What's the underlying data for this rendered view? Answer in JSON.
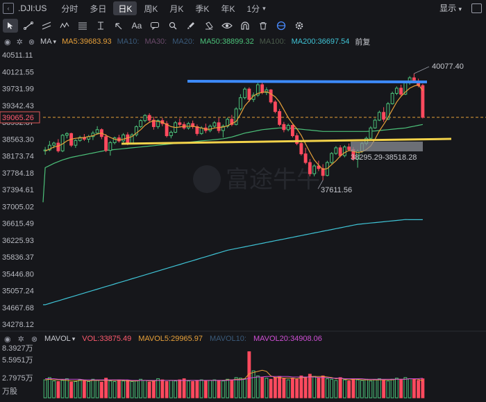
{
  "header": {
    "symbol": ".DJI:US",
    "tabs": [
      "分时",
      "多日",
      "日K",
      "周K",
      "月K",
      "季K",
      "年K",
      "1分"
    ],
    "active_tab": "日K",
    "display_label": "显示"
  },
  "toolbar": {
    "text_tool": "Aa",
    "icons": [
      "cursor-icon",
      "trendline-icon",
      "channel-icon",
      "wave-icon",
      "fib-icon",
      "ruler-icon",
      "arrow-icon",
      "text-icon",
      "comment-icon",
      "zoom-icon",
      "brush-icon",
      "eraser-icon",
      "eye-icon",
      "magnet-icon",
      "trash-icon",
      "sync-icon",
      "settings-icon"
    ]
  },
  "ma_legend": {
    "label": "MA",
    "items": [
      {
        "text": "MA5:39683.93",
        "color": "#e8a13a"
      },
      {
        "text": "MA10:",
        "color": "#3a5a7a"
      },
      {
        "text": "MA30:",
        "color": "#6a4a6a"
      },
      {
        "text": "MA20:",
        "color": "#3a5a7a"
      },
      {
        "text": "MA50:38899.32",
        "color": "#4cc27a"
      },
      {
        "text": "MA100:",
        "color": "#4a5a4a"
      },
      {
        "text": "MA200:36697.54",
        "color": "#3fc4d6"
      },
      {
        "text": "前复",
        "color": "#c7c9cf"
      }
    ]
  },
  "vol_legend": {
    "label": "MAVOL",
    "items": [
      {
        "text": "VOL:33875.49",
        "color": "#ff5a6e"
      },
      {
        "text": "MAVOL5:29965.97",
        "color": "#e8a13a"
      },
      {
        "text": "MAVOL10:",
        "color": "#3a5a7a"
      },
      {
        "text": "MAVOL20:34908.06",
        "color": "#d04fd6"
      }
    ]
  },
  "watermark": "富途牛牛",
  "chart_data": {
    "type": "candlestick",
    "y_ticks": [
      "40511.11",
      "40121.55",
      "39731.99",
      "39342.43",
      "38952.87",
      "38563.30",
      "38173.74",
      "37784.18",
      "37394.61",
      "37005.02",
      "36615.49",
      "36225.93",
      "35836.37",
      "35446.80",
      "35057.24",
      "34667.68",
      "34278.12"
    ],
    "ylim": [
      34278.12,
      40511.11
    ],
    "current_price": "39065.26",
    "annotations": {
      "high_label": "40077.40",
      "low_label": "37611.56",
      "range_label": "38295.29-38518.28"
    },
    "candles": [
      [
        38290,
        38380,
        38200,
        38310
      ],
      [
        38310,
        38520,
        38280,
        38420
      ],
      [
        38420,
        38500,
        38350,
        38470
      ],
      [
        38470,
        38560,
        38250,
        38290
      ],
      [
        38290,
        38680,
        38260,
        38650
      ],
      [
        38650,
        38720,
        38580,
        38690
      ],
      [
        38690,
        38710,
        38380,
        38420
      ],
      [
        38420,
        38560,
        38360,
        38530
      ],
      [
        38530,
        38640,
        38500,
        38600
      ],
      [
        38600,
        38680,
        38520,
        38560
      ],
      [
        38560,
        38660,
        38480,
        38620
      ],
      [
        38620,
        38750,
        38540,
        38700
      ],
      [
        38700,
        38860,
        38670,
        38780
      ],
      [
        38780,
        38810,
        38560,
        38620
      ],
      [
        38620,
        38680,
        38260,
        38300
      ],
      [
        38300,
        38520,
        38180,
        38480
      ],
      [
        38480,
        38620,
        38440,
        38590
      ],
      [
        38590,
        38660,
        38480,
        38520
      ],
      [
        38520,
        38700,
        38480,
        38660
      ],
      [
        38660,
        38720,
        38420,
        38460
      ],
      [
        38460,
        38700,
        38440,
        38660
      ],
      [
        38660,
        38880,
        38620,
        38850
      ],
      [
        38850,
        39020,
        38820,
        38990
      ],
      [
        38990,
        39140,
        38950,
        39110
      ],
      [
        39110,
        39160,
        38960,
        39000
      ],
      [
        39000,
        39080,
        38780,
        38850
      ],
      [
        38850,
        39020,
        38800,
        38990
      ],
      [
        38990,
        39050,
        38860,
        38920
      ],
      [
        38920,
        38980,
        38600,
        38640
      ],
      [
        38640,
        38760,
        38580,
        38720
      ],
      [
        38720,
        38980,
        38700,
        38940
      ],
      [
        38940,
        39040,
        38850,
        38900
      ],
      [
        38900,
        38960,
        38780,
        38820
      ],
      [
        38820,
        38960,
        38780,
        38920
      ],
      [
        38920,
        38990,
        38800,
        38850
      ],
      [
        38850,
        38900,
        38640,
        38690
      ],
      [
        38690,
        38860,
        38660,
        38820
      ],
      [
        38820,
        38920,
        38700,
        38760
      ],
      [
        38760,
        38900,
        38720,
        38860
      ],
      [
        38860,
        38980,
        38820,
        38940
      ],
      [
        38940,
        39050,
        38700,
        38760
      ],
      [
        38760,
        38900,
        38600,
        38860
      ],
      [
        38860,
        39060,
        38820,
        39020
      ],
      [
        39020,
        39120,
        38860,
        38900
      ],
      [
        38900,
        39300,
        38880,
        39260
      ],
      [
        39260,
        39600,
        39220,
        39520
      ],
      [
        39520,
        39760,
        39480,
        39720
      ],
      [
        39720,
        39760,
        39420,
        39480
      ],
      [
        39480,
        39640,
        39420,
        39580
      ],
      [
        39580,
        39860,
        39540,
        39820
      ],
      [
        39820,
        39880,
        39600,
        39640
      ],
      [
        39640,
        39760,
        39580,
        39700
      ],
      [
        39700,
        39720,
        39380,
        39420
      ],
      [
        39420,
        39460,
        39160,
        39200
      ],
      [
        39200,
        39260,
        38860,
        38900
      ],
      [
        38900,
        38960,
        38720,
        38780
      ],
      [
        38780,
        38920,
        38740,
        38880
      ],
      [
        38880,
        38900,
        38600,
        38640
      ],
      [
        38640,
        38700,
        38420,
        38460
      ],
      [
        38460,
        38520,
        38180,
        38220
      ],
      [
        38220,
        38360,
        37980,
        38020
      ],
      [
        38020,
        38100,
        37700,
        37760
      ],
      [
        37760,
        37980,
        37700,
        37940
      ],
      [
        37940,
        38060,
        37820,
        37880
      ],
      [
        37880,
        37980,
        37611.56,
        37720
      ],
      [
        37720,
        38060,
        37700,
        38020
      ],
      [
        38020,
        38260,
        37990,
        38230
      ],
      [
        38230,
        38400,
        38200,
        38360
      ],
      [
        38360,
        38420,
        38140,
        38180
      ],
      [
        38180,
        38420,
        38140,
        38380
      ],
      [
        38380,
        38460,
        38280,
        38320
      ],
      [
        38320,
        38380,
        38060,
        38100
      ],
      [
        38100,
        38320,
        37900,
        38280
      ],
      [
        38280,
        38500,
        38240,
        38460
      ],
      [
        38460,
        38620,
        38420,
        38580
      ],
      [
        38580,
        38860,
        38560,
        38820
      ],
      [
        38820,
        39040,
        38800,
        39000
      ],
      [
        39000,
        39220,
        38980,
        39180
      ],
      [
        39180,
        39300,
        38960,
        39020
      ],
      [
        39020,
        39420,
        39000,
        39380
      ],
      [
        39380,
        39660,
        39360,
        39620
      ],
      [
        39620,
        39780,
        39580,
        39740
      ],
      [
        39740,
        39820,
        39560,
        39600
      ],
      [
        39600,
        39900,
        39580,
        39860
      ],
      [
        39860,
        40020,
        39820,
        39980
      ],
      [
        39980,
        40077.4,
        39860,
        39900
      ],
      [
        39900,
        39960,
        39760,
        39800
      ],
      [
        39800,
        39840,
        39040,
        39065.26
      ]
    ],
    "ma5": [
      38290,
      38330,
      38380,
      38400,
      38450,
      38520,
      38560,
      38580,
      38590,
      38600,
      38620,
      38640,
      38680,
      38700,
      38650,
      38600,
      38560,
      38540,
      38560,
      38590,
      38620,
      38700,
      38780,
      38880,
      38950,
      38990,
      38970,
      38950,
      38900,
      38850,
      38830,
      38840,
      38860,
      38860,
      38860,
      38840,
      38820,
      38790,
      38790,
      38820,
      38830,
      38840,
      38870,
      38920,
      38970,
      39140,
      39330,
      39450,
      39560,
      39620,
      39640,
      39660,
      39610,
      39540,
      39420,
      39240,
      39060,
      38920,
      38800,
      38650,
      38450,
      38260,
      38080,
      37960,
      37860,
      37880,
      37970,
      38060,
      38170,
      38250,
      38300,
      38280,
      38250,
      38270,
      38320,
      38400,
      38560,
      38750,
      38900,
      39060,
      39240,
      39420,
      39550,
      39650,
      39740,
      39790,
      39820,
      39683.93
    ],
    "ma50": [
      37900,
      37950,
      38000,
      38040,
      38080,
      38110,
      38140,
      38160,
      38180,
      38200,
      38220,
      38240,
      38260,
      38280,
      38300,
      38310,
      38320,
      38330,
      38340,
      38350,
      38360,
      38370,
      38380,
      38390,
      38400,
      38410,
      38420,
      38430,
      38440,
      38450,
      38460,
      38470,
      38480,
      38490,
      38500,
      38510,
      38520,
      38530,
      38540,
      38550,
      38560,
      38570,
      38590,
      38610,
      38640,
      38670,
      38700,
      38720,
      38740,
      38760,
      38780,
      38790,
      38800,
      38810,
      38820,
      38820,
      38820,
      38810,
      38800,
      38790,
      38780,
      38770,
      38760,
      38750,
      38740,
      38740,
      38740,
      38740,
      38740,
      38740,
      38740,
      38740,
      38740,
      38740,
      38740,
      38745,
      38750,
      38760,
      38770,
      38780,
      38790,
      38800,
      38810,
      38820,
      38840,
      38860,
      38880,
      38899.32
    ],
    "ma200": [
      34730,
      34760,
      34790,
      34820,
      34850,
      34880,
      34910,
      34940,
      34970,
      35000,
      35030,
      35060,
      35090,
      35120,
      35150,
      35180,
      35210,
      35240,
      35270,
      35300,
      35330,
      35360,
      35390,
      35420,
      35450,
      35480,
      35510,
      35540,
      35570,
      35600,
      35630,
      35660,
      35690,
      35720,
      35750,
      35780,
      35810,
      35840,
      35870,
      35900,
      35930,
      35960,
      35990,
      36010,
      36030,
      36050,
      36070,
      36090,
      36110,
      36130,
      36150,
      36170,
      36190,
      36210,
      36230,
      36250,
      36270,
      36290,
      36310,
      36330,
      36350,
      36370,
      36390,
      36410,
      36430,
      36450,
      36470,
      36490,
      36510,
      36530,
      36550,
      36570,
      36590,
      36600,
      36610,
      36620,
      36630,
      36640,
      36650,
      36660,
      36670,
      36680,
      36690,
      36700,
      36697.54,
      36697.54,
      36697.54,
      36697.54
    ],
    "volume": {
      "y_ticks": [
        "8.3927万",
        "5.5951万",
        "2.7975万",
        "万股"
      ],
      "ylim": [
        0,
        8.3927
      ],
      "values": [
        3.2,
        3.6,
        3.0,
        2.9,
        3.1,
        3.4,
        2.8,
        2.9,
        3.2,
        3.0,
        2.9,
        3.3,
        3.1,
        2.8,
        3.5,
        3.0,
        2.9,
        3.2,
        3.0,
        3.1,
        2.9,
        3.0,
        3.3,
        3.1,
        2.8,
        3.0,
        3.4,
        3.2,
        2.9,
        3.1,
        3.0,
        3.2,
        3.4,
        3.0,
        2.9,
        3.1,
        3.2,
        3.0,
        3.1,
        3.2,
        3.1,
        3.0,
        3.3,
        3.2,
        3.6,
        3.5,
        3.4,
        8.2,
        4.8,
        3.9,
        3.6,
        3.5,
        3.3,
        3.6,
        3.8,
        3.4,
        3.2,
        3.5,
        3.3,
        3.9,
        3.6,
        4.2,
        3.8,
        3.5,
        3.9,
        3.4,
        3.3,
        3.1,
        3.6,
        3.2,
        3.0,
        3.4,
        3.2,
        3.1,
        3.3,
        3.0,
        3.2,
        3.4,
        3.1,
        3.0,
        3.3,
        3.5,
        3.2,
        3.6,
        3.4,
        3.3,
        3.1,
        3.39
      ],
      "mavol5": [
        3.2,
        3.3,
        3.2,
        3.2,
        3.2,
        3.1,
        3.0,
        3.0,
        3.1,
        3.1,
        3.0,
        3.1,
        3.1,
        3.1,
        3.1,
        3.1,
        3.1,
        3.1,
        3.1,
        3.0,
        3.0,
        3.0,
        3.1,
        3.1,
        3.0,
        3.0,
        3.1,
        3.1,
        3.1,
        3.1,
        3.1,
        3.1,
        3.1,
        3.1,
        3.1,
        3.1,
        3.1,
        3.1,
        3.1,
        3.1,
        3.1,
        3.1,
        3.2,
        3.2,
        3.3,
        3.3,
        3.4,
        4.3,
        4.5,
        4.7,
        4.9,
        4.7,
        3.9,
        3.6,
        3.6,
        3.5,
        3.5,
        3.5,
        3.4,
        3.6,
        3.6,
        3.8,
        3.8,
        3.8,
        3.8,
        3.7,
        3.6,
        3.4,
        3.5,
        3.3,
        3.2,
        3.3,
        3.3,
        3.2,
        3.2,
        3.2,
        3.2,
        3.2,
        3.2,
        3.2,
        3.2,
        3.3,
        3.3,
        3.3,
        3.4,
        3.4,
        3.3,
        3.0
      ],
      "mavol20": [
        3.4,
        3.4,
        3.4,
        3.3,
        3.3,
        3.3,
        3.3,
        3.3,
        3.3,
        3.2,
        3.2,
        3.2,
        3.2,
        3.2,
        3.2,
        3.2,
        3.2,
        3.2,
        3.2,
        3.2,
        3.1,
        3.1,
        3.1,
        3.1,
        3.1,
        3.1,
        3.1,
        3.1,
        3.1,
        3.1,
        3.1,
        3.1,
        3.1,
        3.1,
        3.1,
        3.1,
        3.1,
        3.1,
        3.1,
        3.1,
        3.1,
        3.1,
        3.1,
        3.2,
        3.2,
        3.2,
        3.3,
        3.5,
        3.6,
        3.7,
        3.7,
        3.8,
        3.8,
        3.8,
        3.8,
        3.8,
        3.8,
        3.7,
        3.7,
        3.7,
        3.7,
        3.7,
        3.7,
        3.6,
        3.6,
        3.6,
        3.5,
        3.5,
        3.5,
        3.4,
        3.4,
        3.4,
        3.4,
        3.4,
        3.3,
        3.3,
        3.3,
        3.3,
        3.3,
        3.3,
        3.3,
        3.3,
        3.3,
        3.3,
        3.4,
        3.4,
        3.4,
        3.49
      ]
    }
  }
}
